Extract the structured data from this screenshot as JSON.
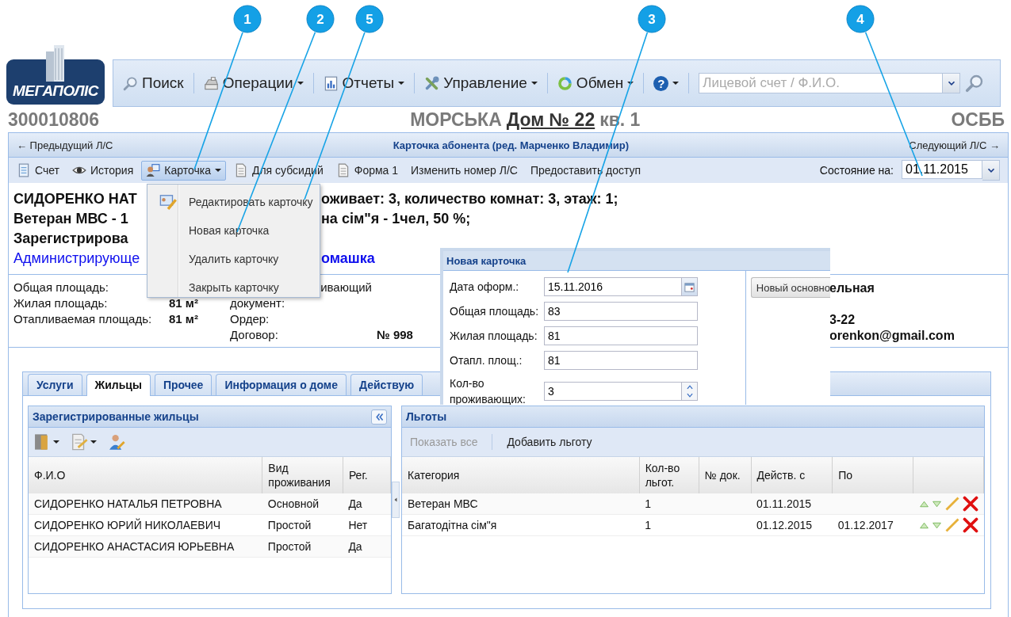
{
  "callouts": [
    {
      "number": "1"
    },
    {
      "number": "2"
    },
    {
      "number": "5"
    },
    {
      "number": "3"
    },
    {
      "number": "4"
    }
  ],
  "logo": {
    "text": "МЕГАПОЛІС"
  },
  "main_toolbar": {
    "items": [
      {
        "label": "Поиск",
        "dropdown": false
      },
      {
        "label": "Операции",
        "dropdown": true
      },
      {
        "label": "Отчеты",
        "dropdown": true
      },
      {
        "label": "Управление",
        "dropdown": true
      },
      {
        "label": "Обмен",
        "dropdown": true
      },
      {
        "glyph": "?",
        "dropdown": true
      }
    ],
    "search": {
      "placeholder": "Лицевой счет / Ф.И.О."
    }
  },
  "account": {
    "number": "300010806",
    "street": "МОРСЬКА",
    "house": "Дом № 22",
    "flat": "кв. 1",
    "type": "ОСББ"
  },
  "card_header": {
    "prev": "← Предыдущий Л/С",
    "title": "Карточка абонента (ред. Марченко Владимир)",
    "next": "Следующий Л/С →"
  },
  "card_toolbar": {
    "items": [
      {
        "label": "Счет",
        "pressed": false,
        "dropdown": false
      },
      {
        "label": "История",
        "pressed": false,
        "dropdown": false
      },
      {
        "label": "Карточка",
        "pressed": true,
        "dropdown": true
      },
      {
        "label": "Для субсидий",
        "pressed": false,
        "dropdown": false
      },
      {
        "label": "Форма 1",
        "pressed": false,
        "dropdown": false
      },
      {
        "label": "Изменить номер Л/С",
        "pressed": false,
        "dropdown": false
      },
      {
        "label": "Предоставить доступ",
        "pressed": false,
        "dropdown": false
      }
    ],
    "state_label": "Состояние на:",
    "state_date": "01.11.2015"
  },
  "summary": {
    "lines": [
      {
        "kind": "bold",
        "left": "СИДОРЕНКО НАТ",
        "right": "оживает: 3, количество комнат: 3, этаж: 1;"
      },
      {
        "kind": "bold",
        "left": "Ветеран МВС - 1",
        "right": "на сім\"я - 1чел, 50 %;"
      },
      {
        "kind": "bold",
        "left": "Зарегистрирова"
      },
      {
        "kind": "link",
        "left": "Администрирующе",
        "right": "омашка"
      }
    ]
  },
  "details": {
    "areas": [
      {
        "label": "Общая площадь:"
      },
      {
        "label": "Жилая площадь:",
        "value": "81 м²"
      },
      {
        "label": "Отапливаемая площадь:",
        "value": "81 м²"
      }
    ],
    "documents": [
      {
        "label": "ивающий"
      },
      {
        "label": "документ:"
      },
      {
        "label": "Ордер:"
      },
      {
        "label": "Договор:",
        "value": "№ 998"
      }
    ],
    "contacts": [
      "ельная",
      "3-22",
      "orenkon@gmail.com"
    ]
  },
  "card_menu": {
    "items": [
      {
        "label": "Редактировать карточку"
      },
      {
        "label": "Новая карточка"
      },
      {
        "label": "Удалить карточку"
      },
      {
        "label": "Закрыть карточку"
      }
    ]
  },
  "dialog": {
    "title": "Новая карточка",
    "fields": [
      {
        "kind": "date",
        "label": "Дата оформ.:",
        "value": "15.11.2016"
      },
      {
        "kind": "text",
        "label": "Общая площадь:",
        "value": "83"
      },
      {
        "kind": "text",
        "label": "Жилая площадь:",
        "value": "81"
      },
      {
        "kind": "text",
        "label": "Отапл. площ.:",
        "value": "81"
      },
      {
        "kind": "spinner",
        "label": "Кол-во проживающих:",
        "value": "3"
      }
    ],
    "button": "Новый основно"
  },
  "tabs": [
    {
      "label": "Услуги",
      "selected": false
    },
    {
      "label": "Жильцы",
      "selected": true
    },
    {
      "label": "Прочее",
      "selected": false
    },
    {
      "label": "Информация о доме",
      "selected": false
    },
    {
      "label": "Действую",
      "selected": false
    }
  ],
  "residents": {
    "title": "Зарегистрированные жильцы",
    "columns": [
      "Ф.И.О",
      "Вид проживания",
      "Рег."
    ],
    "rows": [
      [
        "СИДОРЕНКО НАТАЛЬЯ ПЕТРОВНА",
        "Основной",
        "Да"
      ],
      [
        "СИДОРЕНКО ЮРИЙ НИКОЛАЕВИЧ",
        "Простой",
        "Нет"
      ],
      [
        "СИДОРЕНКО АНАСТАСИЯ ЮРЬЕВНА",
        "Простой",
        "Да"
      ]
    ]
  },
  "benefits": {
    "title": "Льготы",
    "actions": [
      {
        "label": "Показать все",
        "disabled": true
      },
      {
        "label": "Добавить льготу",
        "disabled": false
      }
    ],
    "columns": [
      "Категория",
      "Кол-во льгот.",
      "№ док.",
      "Действ. с",
      "По"
    ],
    "rows": [
      {
        "category": "Ветеран МВС",
        "count": "1",
        "from": "01.11.2015"
      },
      {
        "category": "Багатодітна сім\"я",
        "count": "1",
        "from": "01.12.2015",
        "to": "01.12.2017"
      }
    ]
  }
}
